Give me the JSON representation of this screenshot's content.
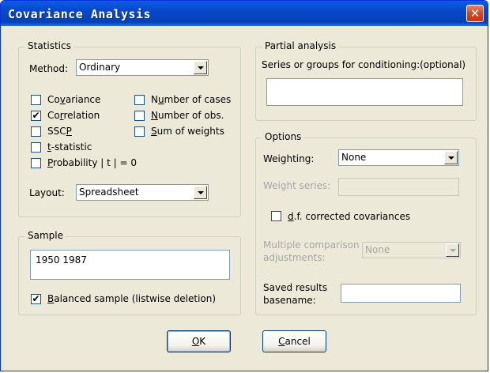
{
  "window": {
    "title": "Covariance Analysis",
    "close_glyph": "✕"
  },
  "statistics": {
    "legend": "Statistics",
    "method_label": "Method:",
    "method_value": "Ordinary",
    "checkboxes": [
      {
        "pre": "Co",
        "key": "v",
        "post": "ariance",
        "checked": false
      },
      {
        "pre": "Co",
        "key": "r",
        "post": "relation",
        "checked": true
      },
      {
        "pre": "SSC",
        "key": "P",
        "post": "",
        "checked": false
      },
      {
        "pre": "",
        "key": "t",
        "post": "-statistic",
        "checked": false
      },
      {
        "pre": "",
        "key": "P",
        "post": "robability | t | = 0",
        "checked": false
      },
      {
        "pre": "N",
        "key": "u",
        "post": "mber of cases",
        "checked": false
      },
      {
        "pre": "",
        "key": "N",
        "post": "umber of obs.",
        "checked": false
      },
      {
        "pre": "",
        "key": "S",
        "post": "um of weights",
        "checked": false
      }
    ],
    "layout_label": "Layout:",
    "layout_value": "Spreadsheet"
  },
  "sample": {
    "legend": "Sample",
    "value": "1950 1987",
    "balanced": {
      "pre": "",
      "key": "B",
      "post": "alanced sample (listwise deletion)",
      "checked": true
    }
  },
  "partial": {
    "legend": "Partial analysis",
    "label": "Series or groups for conditioning:(optional)",
    "value": ""
  },
  "options": {
    "legend": "Options",
    "weighting_label": "Weighting:",
    "weighting_value": "None",
    "weight_series_label": "Weight series:",
    "df_corrected": {
      "pre": "",
      "key": "d",
      "post": ".f. corrected covariances",
      "checked": false
    },
    "multiple_label_1": "Multiple comparison",
    "multiple_label_2": "adjustments:",
    "multiple_value": "None",
    "saved_label_1": "Saved results",
    "saved_label_2": "basename:",
    "saved_value": ""
  },
  "buttons": {
    "ok": {
      "pre": "",
      "key": "O",
      "post": "K"
    },
    "cancel": {
      "pre": "",
      "key": "C",
      "post": "ancel"
    }
  },
  "checkmark_glyph": "✔"
}
